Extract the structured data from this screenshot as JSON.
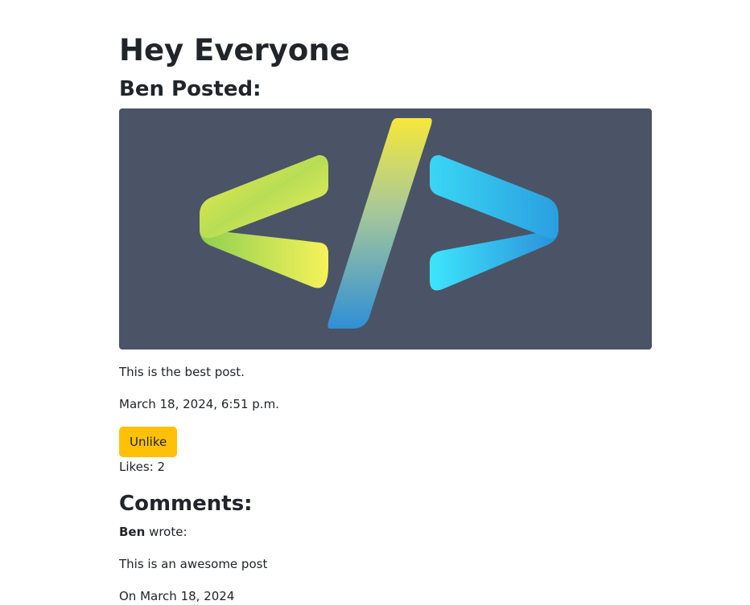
{
  "page": {
    "title": "Hey Everyone",
    "posted_by": "Ben Posted:"
  },
  "post": {
    "image_subject": "code-brackets-logo",
    "colors": {
      "image_bg": "#4a5466",
      "green_yellow": "#c6e24a",
      "cyan_blue": "#33c2f0",
      "unlike_button": "#ffc107"
    },
    "body": "This is the best post.",
    "timestamp": "March 18, 2024, 6:51 p.m.",
    "unlike_label": "Unlike",
    "likes": "Likes: 2"
  },
  "comments": {
    "heading": "Comments:",
    "items": [
      {
        "author": "Ben",
        "wrote": "wrote:",
        "body": "This is an awesome post",
        "date": "On March 18, 2024"
      }
    ]
  }
}
